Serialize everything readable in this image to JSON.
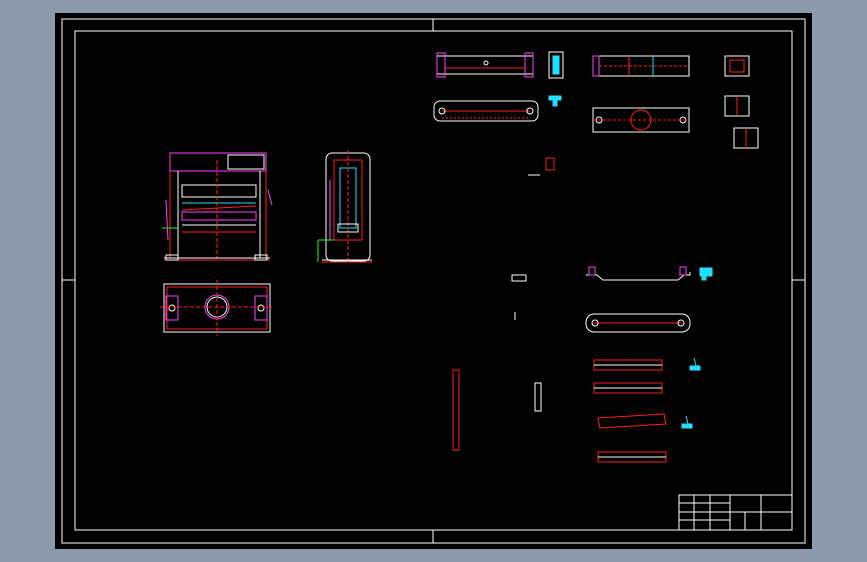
{
  "app": {
    "background_color": "#8d9aab",
    "sheet_color": "#000000",
    "frame_color": "#ffffff"
  },
  "colors": {
    "red": "#ff2020",
    "magenta": "#ff40ff",
    "cyan": "#20e0ff",
    "white": "#ffffff",
    "green": "#20ff20",
    "yellow": "#ffff40"
  },
  "title_block": {
    "cells": [
      "",
      "",
      "",
      "",
      "",
      ""
    ]
  },
  "views": [
    "press-front-view",
    "press-side-view",
    "press-top-view",
    "beam-part-views",
    "plate-part-views",
    "rail-part-views",
    "small-component-views"
  ]
}
